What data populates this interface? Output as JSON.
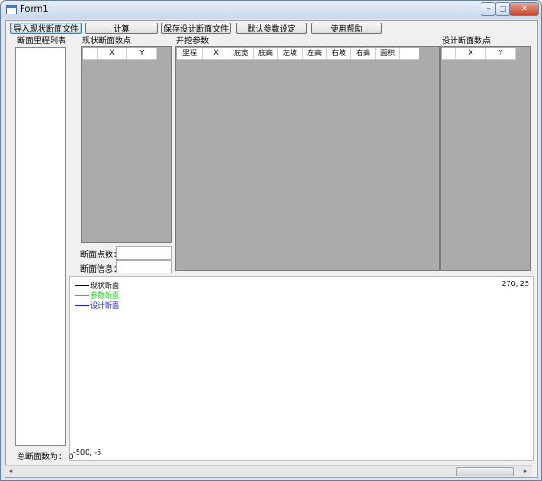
{
  "window": {
    "title": "Form1",
    "min_glyph": "–",
    "max_glyph": "□",
    "close_glyph": "✕"
  },
  "toolbar": {
    "import_label": "导入现状断面文件",
    "compute_label": "计算",
    "save_label": "保存设计断面文件",
    "defaults_label": "默认参数设定",
    "help_label": "使用帮助"
  },
  "sections": {
    "list_title": "断面里程列表",
    "current_points_title": "现状断面数点",
    "excavation_title": "开挖参数",
    "design_points_title": "设计断面数点"
  },
  "current_grid": {
    "columns": [
      "X",
      "Y"
    ]
  },
  "excavation_grid": {
    "columns": [
      "里程",
      "X",
      "底宽",
      "底高",
      "左坡",
      "左高",
      "右坡",
      "右高",
      "面积"
    ]
  },
  "design_grid": {
    "columns": [
      "X",
      "Y"
    ]
  },
  "fields": {
    "point_count_label": "断面点数：",
    "info_label": "断面信息：",
    "point_count_value": "",
    "info_value": ""
  },
  "status": {
    "total_label": "总断面数为： 0"
  },
  "plot": {
    "legend": [
      {
        "label": "现状断面",
        "color": "#000000"
      },
      {
        "label": "参数断面",
        "color": "#22cc22"
      },
      {
        "label": "设计断面",
        "color": "#1a1acc"
      }
    ],
    "coord_top_right": "270, 25",
    "coord_bottom_left": "-500, -5"
  },
  "scrollbar": {
    "left_arrow": "◂",
    "right_arrow": "▸"
  }
}
